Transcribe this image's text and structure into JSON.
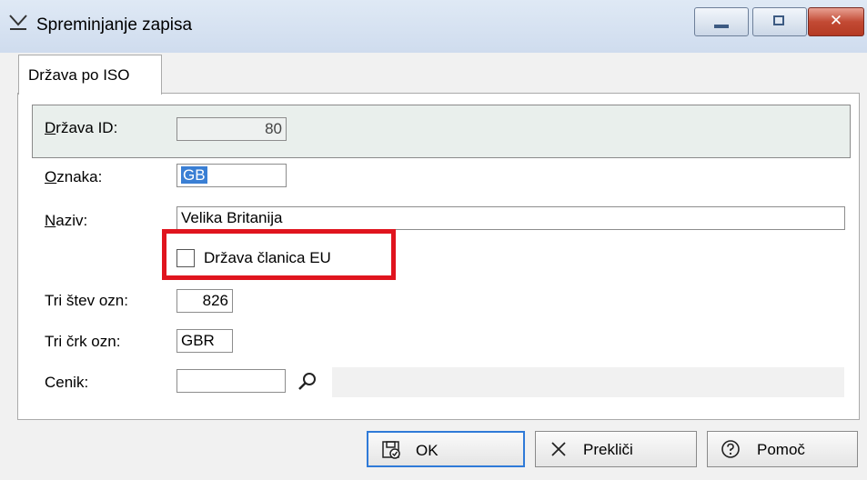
{
  "window": {
    "title": "Spreminjanje zapisa",
    "close_glyph": "✕"
  },
  "tab": {
    "label": "Država po ISO"
  },
  "form": {
    "drzava_id": {
      "label_u": "D",
      "label_rest": "ržava ID:",
      "value": "80"
    },
    "oznaka": {
      "label_u": "O",
      "label_rest": "znaka:",
      "value": "GB"
    },
    "naziv": {
      "label_u": "N",
      "label_rest": "aziv:",
      "value": "Velika Britanija"
    },
    "eu_member": {
      "label": "Država članica EU",
      "checked": false
    },
    "tri_stev": {
      "label": "Tri štev ozn:",
      "value": "826"
    },
    "tri_crk": {
      "label": "Tri črk ozn:",
      "value": "GBR"
    },
    "cenik": {
      "label": "Cenik:",
      "value": ""
    }
  },
  "buttons": {
    "ok": "OK",
    "cancel": "Prekliči",
    "help": "Pomoč"
  },
  "colors": {
    "highlight": "#e0141e",
    "selection": "#3a7fd4",
    "ok_border": "#2f7ad8"
  },
  "icons": [
    "form-edit-icon",
    "minimize-icon",
    "maximize-icon",
    "close-icon",
    "search-icon",
    "save-icon",
    "cancel-x-icon",
    "help-icon"
  ]
}
